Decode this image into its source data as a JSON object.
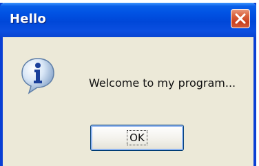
{
  "window": {
    "title": "Hello"
  },
  "titlebar": {
    "close_icon": "close-x-icon"
  },
  "dialog": {
    "icon": "information-icon",
    "message": "Welcome to my program...",
    "ok_label": "OK"
  },
  "colors": {
    "titlebar_blue": "#0153e4",
    "frame_blue": "#0a3fd4",
    "dialog_background": "#ece9d8",
    "close_button_red": "#c94020",
    "button_focus_border": "#8fb4f0"
  }
}
